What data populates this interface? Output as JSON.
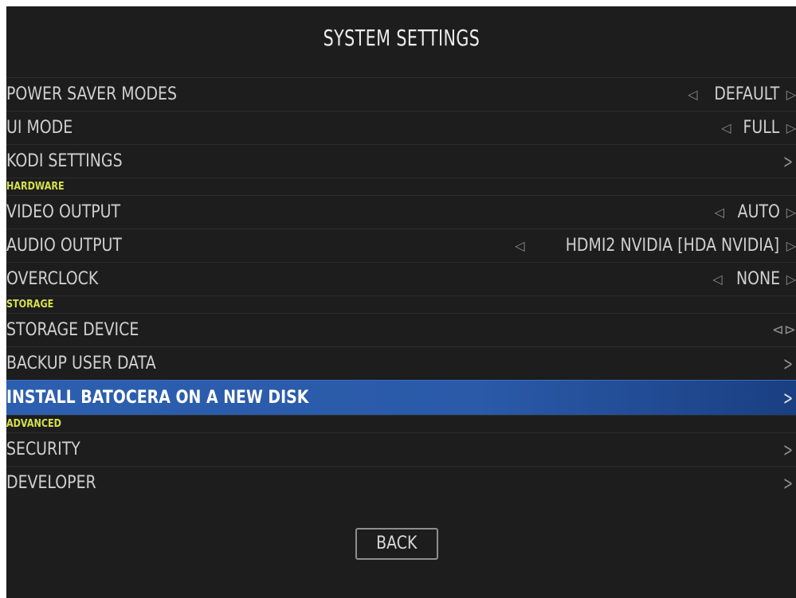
{
  "title": "SYSTEM SETTINGS",
  "sections": {
    "hardware": "HARDWARE",
    "storage": "STORAGE",
    "advanced": "ADVANCED"
  },
  "items": {
    "power_saver": {
      "label": "POWER SAVER MODES",
      "value": "DEFAULT"
    },
    "ui_mode": {
      "label": "UI MODE",
      "value": "FULL"
    },
    "kodi": {
      "label": "KODI SETTINGS"
    },
    "video_output": {
      "label": "VIDEO OUTPUT",
      "value": "AUTO"
    },
    "audio_output": {
      "label": "AUDIO OUTPUT",
      "value": "HDMI2 NVIDIA [HDA NVIDIA]"
    },
    "overclock": {
      "label": "OVERCLOCK",
      "value": "NONE"
    },
    "storage_device": {
      "label": "STORAGE DEVICE"
    },
    "backup": {
      "label": "BACKUP USER DATA"
    },
    "install": {
      "label": "INSTALL BATOCERA ON A NEW DISK"
    },
    "security": {
      "label": "SECURITY"
    },
    "developer": {
      "label": "DEVELOPER"
    }
  },
  "back_label": "BACK",
  "colors": {
    "background": "#1d1d1d",
    "section_header": "#d6e04a",
    "selected": "#2d5fb0",
    "text": "#cfcfcf"
  }
}
